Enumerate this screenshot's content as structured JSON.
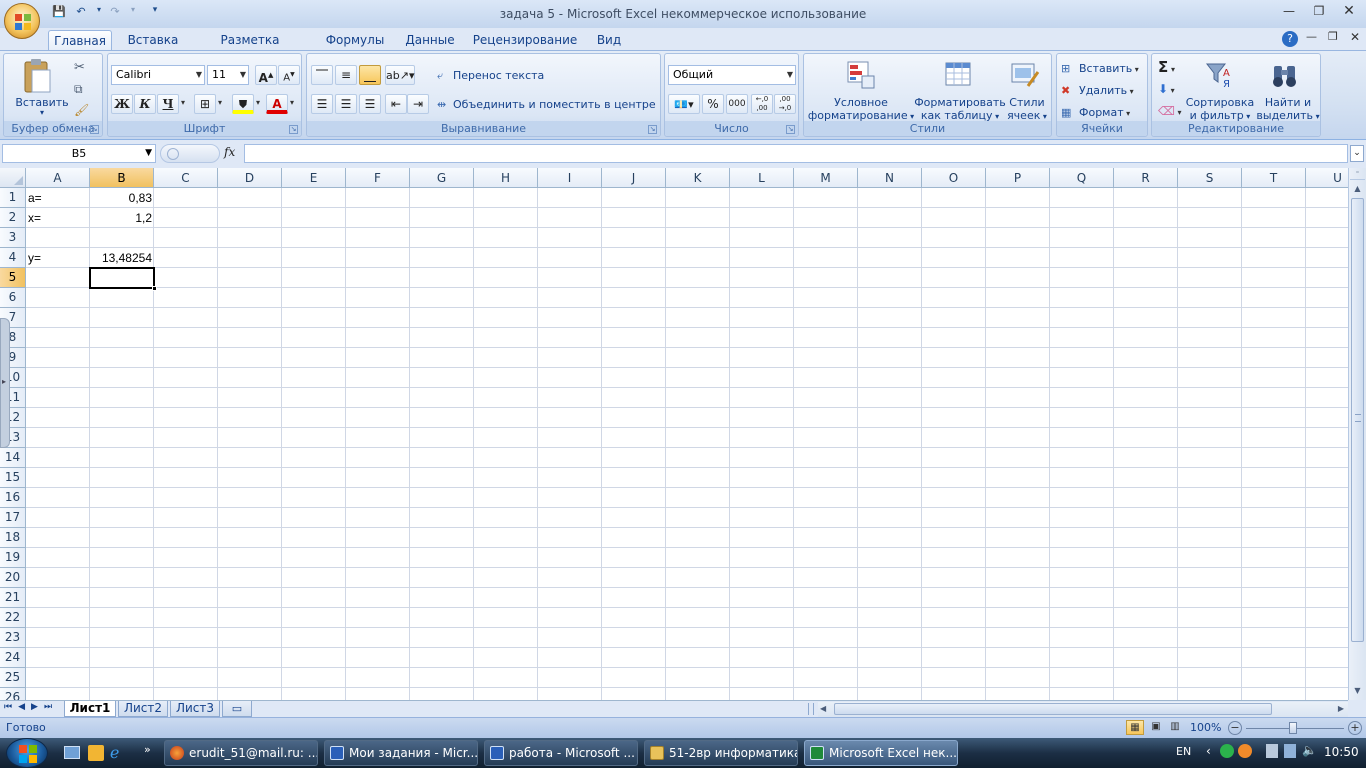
{
  "window": {
    "title": "задача 5 - Microsoft Excel некоммерческое использование"
  },
  "tabs": [
    "Главная",
    "Вставка",
    "Разметка страницы",
    "Формулы",
    "Данные",
    "Рецензирование",
    "Вид"
  ],
  "ribbon": {
    "clipboard": {
      "label": "Буфер обмена",
      "paste": "Вставить"
    },
    "font": {
      "label": "Шрифт",
      "name": "Calibri",
      "size": "11",
      "bold": "Ж",
      "italic": "К",
      "underline": "Ч",
      "grow": "A",
      "shrink": "A",
      "font_color_letter": "A"
    },
    "alignment": {
      "label": "Выравнивание",
      "wrap": "Перенос текста",
      "merge": "Объединить и поместить в центре"
    },
    "number": {
      "label": "Число",
      "format": "Общий",
      "percent": "%",
      "thousands": "000",
      "inc": "←,0 ,00",
      "dec": ",00 →,0"
    },
    "styles": {
      "label": "Стили",
      "cond1": "Условное",
      "cond2": "форматирование",
      "table1": "Форматировать",
      "table2": "как таблицу",
      "cell1": "Стили",
      "cell2": "ячеек"
    },
    "cells": {
      "label": "Ячейки",
      "insert": "Вставить",
      "delete": "Удалить",
      "format": "Формат"
    },
    "editing": {
      "label": "Редактирование",
      "sigma": "Σ",
      "sort1": "Сортировка",
      "sort2": "и фильтр",
      "find1": "Найти и",
      "find2": "выделить"
    }
  },
  "formula_bar": {
    "name_box": "B5",
    "fx": "fx",
    "value": ""
  },
  "columns": [
    "A",
    "B",
    "C",
    "D",
    "E",
    "F",
    "G",
    "H",
    "I",
    "J",
    "K",
    "L",
    "M",
    "N",
    "O",
    "P",
    "Q",
    "R",
    "S",
    "T",
    "U"
  ],
  "rows": [
    "1",
    "2",
    "3",
    "4",
    "5",
    "6",
    "7",
    "8",
    "9",
    "10",
    "11",
    "12",
    "13",
    "14",
    "15",
    "16",
    "17",
    "18",
    "19",
    "20",
    "21",
    "22",
    "23",
    "24",
    "25",
    "26"
  ],
  "cells": {
    "A1": "a=",
    "B1": "0,83",
    "A2": "x=",
    "B2": "1,2",
    "A4": "y=",
    "B4": "13,48254"
  },
  "sheets": [
    "Лист1",
    "Лист2",
    "Лист3"
  ],
  "status": {
    "ready": "Готово",
    "zoom": "100%"
  },
  "taskbar": {
    "items": [
      "erudit_51@mail.ru: ...",
      "Мои задания - Micr...",
      "работа - Microsoft ...",
      "51-2вр информатика",
      "Microsoft Excel нек..."
    ],
    "lang": "EN",
    "time": "10:50"
  },
  "colors": {
    "selected_header": "#f1c15f",
    "grid_line": "#d0d7e5",
    "ribbon_text": "#15428b"
  }
}
